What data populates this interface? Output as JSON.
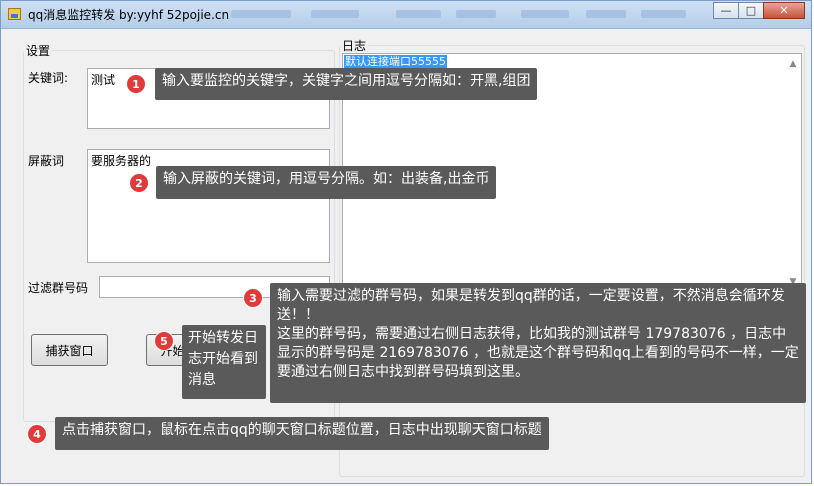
{
  "window": {
    "title": "qq消息监控转发 by:yyhf  52pojie.cn",
    "controls": {
      "minimize": "—",
      "maximize": "□",
      "close": "✕"
    }
  },
  "settings": {
    "legend": "设置",
    "keyword_label": "关键词:",
    "keyword_value": "测试",
    "block_label": "屏蔽词",
    "block_value": "要服务器的",
    "group_filter_label": "过滤群号码",
    "group_filter_value": "",
    "capture_button": "捕获窗口",
    "start_button": "开始转发"
  },
  "log": {
    "legend": "日志",
    "lines": [
      "默认连接端口55555"
    ]
  },
  "annotations": [
    {
      "number": "1",
      "text": "输入要监控的关键字，关键字之间用逗号分隔如：开黑,组团"
    },
    {
      "number": "2",
      "text": "输入屏蔽的关键词，用逗号分隔。如：出装备,出金币"
    },
    {
      "number": "3",
      "text": "输入需要过滤的群号码，如果是转发到qq群的话，一定要设置，不然消息会循环发送！！\n这里的群号码，需要通过右侧日志获得，比如我的测试群号 179783076 ，日志中显示的群号码是 2169783076 ，也就是这个群号码和qq上看到的号码不一样，一定要通过右侧日志中找到群号码填到这里。"
    },
    {
      "number": "4",
      "text": "点击捕获窗口，鼠标在点击qq的聊天窗口标题位置，日志中出现聊天窗口标题"
    },
    {
      "number": "5",
      "text": "开始转发日志开始看到消息"
    }
  ],
  "colors": {
    "callout_bg": "#5a5a5a",
    "badge_bg": "#e03a3a",
    "selection": "#3399ff"
  }
}
